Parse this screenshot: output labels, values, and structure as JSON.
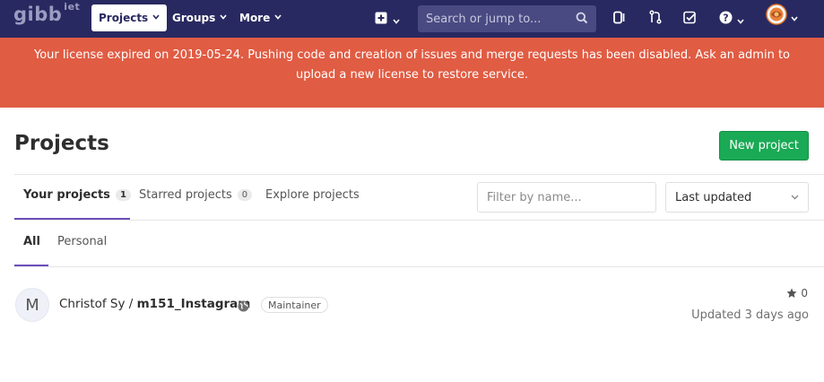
{
  "navbar": {
    "logo": "gibb",
    "logo_sup": "iet",
    "projects_label": "Projects",
    "groups_label": "Groups",
    "more_label": "More",
    "search_placeholder": "Search or jump to...",
    "brand_color": "#292961"
  },
  "banner": {
    "text": "Your license expired on 2019-05-24. Pushing code and creation of issues and merge requests has been disabled. Ask an admin to upload a new license to restore service.",
    "color": "#e05c43"
  },
  "page": {
    "title": "Projects",
    "new_project_label": "New project"
  },
  "tabs": [
    {
      "label": "Your projects",
      "count": "1",
      "active": true
    },
    {
      "label": "Starred projects",
      "count": "0",
      "active": false
    },
    {
      "label": "Explore projects",
      "active": false
    }
  ],
  "filter": {
    "placeholder": "Filter by name..."
  },
  "sort": {
    "selected": "Last updated"
  },
  "subtabs": [
    {
      "label": "All",
      "active": true
    },
    {
      "label": "Personal",
      "active": false
    }
  ],
  "projects": [
    {
      "avatar_letter": "M",
      "namespace": "Christof Sy / ",
      "name": "m151_Instagram",
      "visibility_icon": "globe-icon",
      "role": "Maintainer",
      "stars": "0",
      "updated": "Updated 3 days ago"
    }
  ]
}
